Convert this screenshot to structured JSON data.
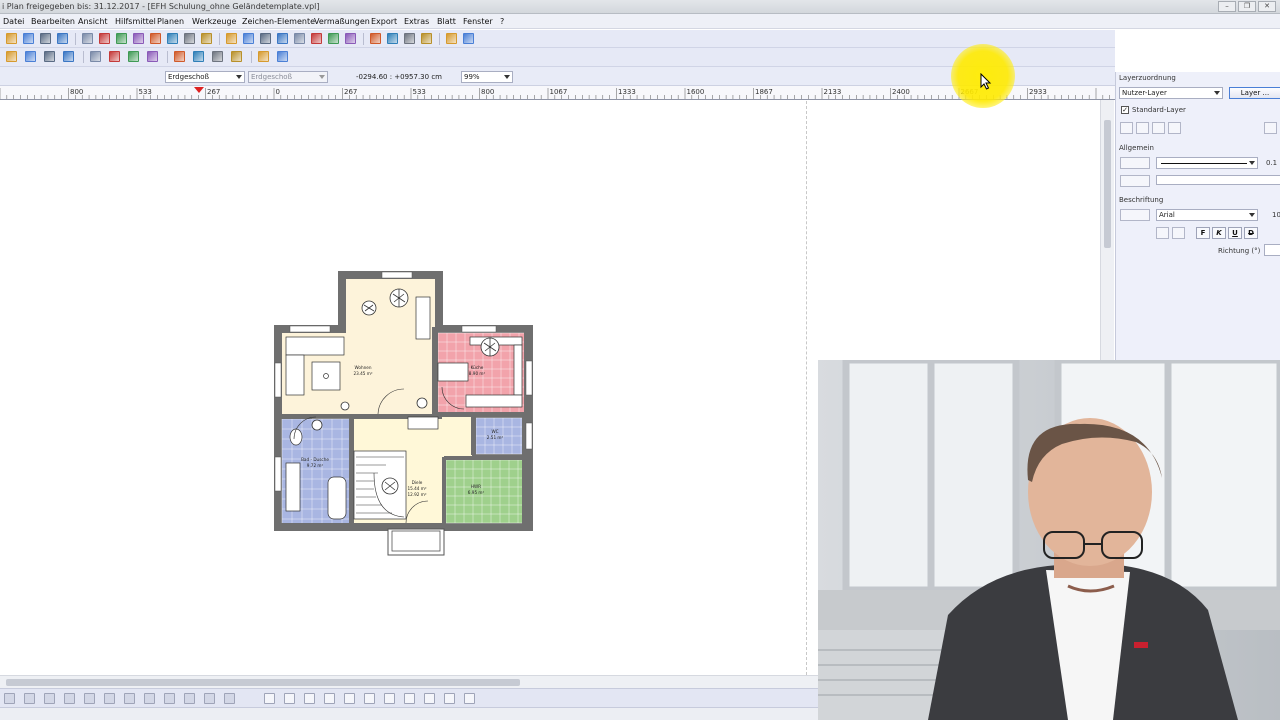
{
  "window": {
    "title": "i Plan freigegeben bis: 31.12.2017 - [EFH Schulung_ohne Geländetemplate.vpl]"
  },
  "menu": [
    "Datei",
    "Bearbeiten",
    "Ansicht",
    "Hilfsmittel",
    "Planen",
    "Werkzeuge",
    "Zeichen-Elemente",
    "Vermaßungen",
    "Export",
    "Extras",
    "Blatt",
    "Fenster",
    "?"
  ],
  "selector": {
    "floor_active": "Erdgeschoß",
    "floor_reference": "Erdgeschoß",
    "coordinates": "-0294.60 : +0957.30 cm",
    "zoom": "99%"
  },
  "ruler": {
    "labels": [
      "800",
      "533",
      "267",
      "0",
      "267",
      "533",
      "800",
      "1067",
      "1333",
      "1600",
      "1867",
      "2133",
      "2400",
      "2667",
      "2933"
    ]
  },
  "floorplan": {
    "rooms": [
      {
        "name": "Wohnen",
        "area": "23.45 m²"
      },
      {
        "name": "Küche",
        "area": "8.90 m²"
      },
      {
        "name": "Bad - Dusche",
        "area": "9.72 m²"
      },
      {
        "name": "WC",
        "area": "2.51 m²"
      },
      {
        "name": "Diele",
        "area": "15.44 m²",
        "area2": "12.92 m²"
      },
      {
        "name": "HWR",
        "area": "6.95 m²"
      }
    ],
    "colors": {
      "wall": "#6f6f6f",
      "wohnen": "#fdf3da",
      "kueche": "#f2a3ab",
      "bad": "#a9b6e2",
      "wc": "#a9b6e2",
      "diele": "#fff8d8",
      "hwr": "#9fd08c"
    }
  },
  "layer_panel": {
    "section_title": "Layerzuordnung",
    "layer_type": "Nutzer-Layer",
    "layer_button": "Layer ...",
    "standard_layer_label": "Standard-Layer",
    "standard_layer_checked": true,
    "general_title": "Allgemein",
    "line_width": "0.1",
    "labeling_title": "Beschriftung",
    "font": "Arial",
    "font_size": "10",
    "format_buttons": [
      "F",
      "K",
      "U",
      "D"
    ],
    "direction_label": "Richtung (°)"
  },
  "colors": {
    "accent": "#4a7fd6",
    "toolbar_bg": "#e6e9f6",
    "highlight": "#ffec00"
  },
  "icons": {
    "toolbar1": [
      "open-folder-icon",
      "save-icon",
      "print-icon",
      "info-icon",
      "zoom-window-icon",
      "zoom-all-icon",
      "zoom-in-icon",
      "pan-hand-icon",
      "view-icon",
      "layer-view-icon",
      "3d-view-icon",
      "measure-icon",
      "wall-icon",
      "window-icon",
      "door-icon",
      "stair-icon",
      "roof-icon",
      "room-icon",
      "slab-icon",
      "grid-icon",
      "move-icon",
      "text-icon",
      "dimension-icon",
      "object-icon",
      "export-icon",
      "catalog-icon"
    ],
    "toolbar2": [
      "home-icon",
      "floor-up-icon",
      "floor-icon",
      "building-icon",
      "select-icon",
      "snap-icon",
      "ortho-icon",
      "arc-icon",
      "cut-icon",
      "copy-icon",
      "mirror-icon",
      "rotate-icon",
      "delete-icon",
      "euro-icon"
    ]
  }
}
